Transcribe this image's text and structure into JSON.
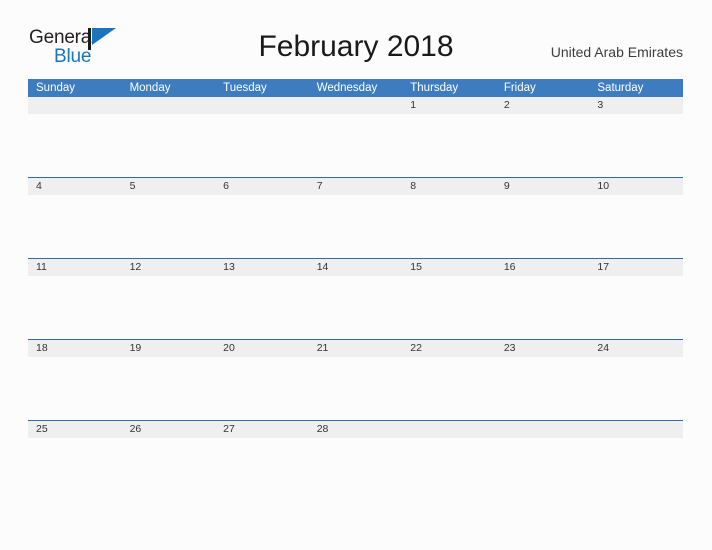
{
  "brand": {
    "name_part1": "General",
    "name_part2": "Blue",
    "flag_icon": "blue-flag-triangle"
  },
  "header": {
    "title": "February 2018",
    "country": "United Arab Emirates"
  },
  "calendar": {
    "weekday_headers": [
      "Sunday",
      "Monday",
      "Tuesday",
      "Wednesday",
      "Thursday",
      "Friday",
      "Saturday"
    ],
    "accent_color": "#3c7cbf",
    "row_divider_color": "#2e6da4",
    "date_band_color": "#efefef",
    "weeks": [
      {
        "days": [
          "",
          "",
          "",
          "",
          "1",
          "2",
          "3"
        ]
      },
      {
        "days": [
          "4",
          "5",
          "6",
          "7",
          "8",
          "9",
          "10"
        ]
      },
      {
        "days": [
          "11",
          "12",
          "13",
          "14",
          "15",
          "16",
          "17"
        ]
      },
      {
        "days": [
          "18",
          "19",
          "20",
          "21",
          "22",
          "23",
          "24"
        ]
      },
      {
        "days": [
          "25",
          "26",
          "27",
          "28",
          "",
          "",
          ""
        ]
      }
    ]
  }
}
